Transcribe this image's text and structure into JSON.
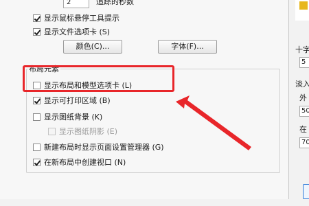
{
  "display_options": {
    "precision_value": "2",
    "precision_label": "追踪的秒数",
    "show_rollover_tooltips": {
      "label": "显示鼠标悬停工具提示",
      "checked": true
    },
    "show_file_tabs": {
      "label": "显示文件选项卡 (S)",
      "checked": true
    },
    "colors_button": "颜色(C)...",
    "fonts_button": "字体(F)..."
  },
  "layout_elements": {
    "title": "布局元素",
    "show_layout_model_tabs": {
      "label": "显示布局和模型选项卡 (L)",
      "checked": false
    },
    "show_printable_area": {
      "label": "显示可打印区域 (B)",
      "checked": true
    },
    "show_paper_background": {
      "label": "显示图纸背景 (K)",
      "checked": false
    },
    "show_paper_shadow": {
      "label": "显示图纸阴影 (E)",
      "checked": false,
      "disabled": true
    },
    "show_page_setup_manager": {
      "label": "新建布局时显示页面设置管理器 (G)",
      "checked": false
    },
    "create_viewport": {
      "label": "在新布局中创建视口 (N)",
      "checked": true
    }
  },
  "side_panel": {
    "crosshair_label": "十字",
    "crosshair_value": "5",
    "fade_label": "淡入",
    "outer_label": "外",
    "outer_value": "50",
    "inplace_label": "在",
    "inplace_value": "70"
  },
  "colors": {
    "highlight": "#e8262a",
    "arrow": "#e8262a"
  }
}
